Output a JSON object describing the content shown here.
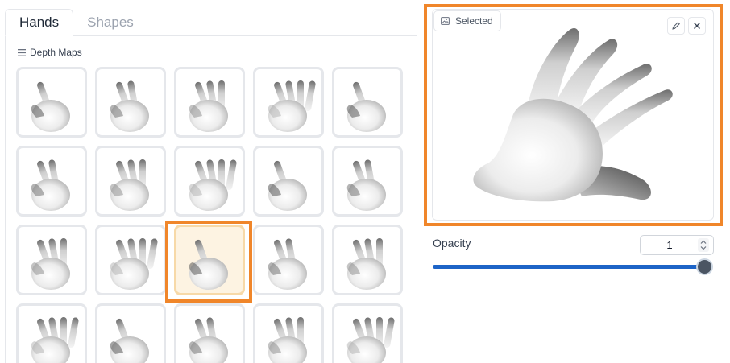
{
  "tabs": [
    {
      "label": "Hands",
      "active": true
    },
    {
      "label": "Shapes",
      "active": false
    }
  ],
  "section": {
    "label": "Depth Maps",
    "icon": "list-icon"
  },
  "gallery": {
    "item_count": 20,
    "selected_index": 12,
    "accent_color": "#f0862a",
    "items": [
      {
        "pose": "fist-index-up"
      },
      {
        "pose": "index-point"
      },
      {
        "pose": "peace"
      },
      {
        "pose": "pointing-two"
      },
      {
        "pose": "pointing-dark"
      },
      {
        "pose": "v-sign-dark"
      },
      {
        "pose": "flat-hand-fingers"
      },
      {
        "pose": "three-fingers-dark"
      },
      {
        "pose": "three-fingers"
      },
      {
        "pose": "three-fingers-spread"
      },
      {
        "pose": "open-hand-light"
      },
      {
        "pose": "open-hand-shaded"
      },
      {
        "pose": "open-hand-spread"
      },
      {
        "pose": "claw-hand"
      },
      {
        "pose": "pinch-c"
      },
      {
        "pose": "c-shape"
      },
      {
        "pose": "index-up-side"
      },
      {
        "pose": "fist-top"
      },
      {
        "pose": "flat-reach"
      },
      {
        "pose": "fist-front"
      }
    ]
  },
  "preview": {
    "badge_label": "Selected",
    "badge_icon": "image-icon",
    "edit_icon": "pencil-icon",
    "close_icon": "close-icon"
  },
  "opacity": {
    "label": "Opacity",
    "value": "1",
    "slider_fraction": 1.0,
    "track_color": "#1d64c7"
  }
}
